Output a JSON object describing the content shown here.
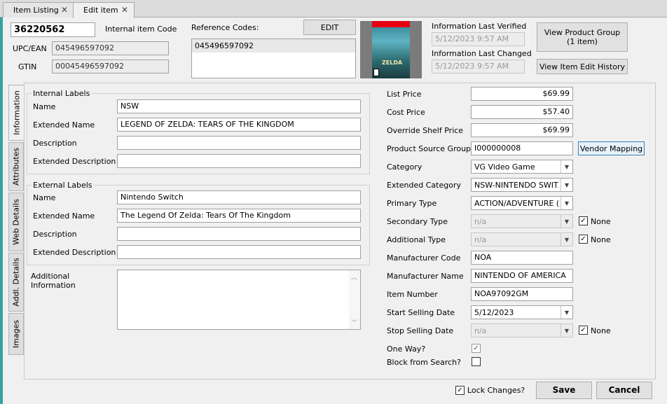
{
  "tabs": [
    {
      "label": "Item Listing"
    },
    {
      "label": "Edit item"
    }
  ],
  "header": {
    "item_code": "36220562",
    "internal_item_code_label": "Internal item Code",
    "upc_label": "UPC/EAN",
    "upc_value": "045496597092",
    "gtin_label": "GTIN",
    "gtin_value": "00045496597092",
    "ref_codes_label": "Reference Codes:",
    "edit_button": "EDIT",
    "ref_codes": [
      "045496597092"
    ],
    "info_verified_label": "Information Last Verified",
    "info_verified_value": "5/12/2023 9:57 AM",
    "info_changed_label": "Information Last Changed",
    "info_changed_value": "5/12/2023 9:57 AM",
    "view_product_group_line1": "View Product Group",
    "view_product_group_line2": "(1 item)",
    "view_edit_history": "View Item Edit History"
  },
  "side_tabs": [
    "Information",
    "Attributes",
    "Web Details",
    "Addl. Details",
    "Images"
  ],
  "internal_labels": {
    "legend": "Internal Labels",
    "name_label": "Name",
    "name": "NSW",
    "ext_name_label": "Extended Name",
    "ext_name": "LEGEND OF ZELDA: TEARS OF THE KINGDOM",
    "desc_label": "Description",
    "desc": "",
    "ext_desc_label": "Extended Description",
    "ext_desc": ""
  },
  "external_labels": {
    "legend": "External Labels",
    "name_label": "Name",
    "name": "Nintendo Switch",
    "ext_name_label": "Extended Name",
    "ext_name": "The Legend Of Zelda: Tears Of The Kingdom",
    "desc_label": "Description",
    "desc": "",
    "ext_desc_label": "Extended Description",
    "ext_desc": ""
  },
  "additional_info": {
    "label_line1": "Additional",
    "label_line2": "Information",
    "value": ""
  },
  "right": {
    "list_price_label": "List Price",
    "list_price": "$69.99",
    "cost_price_label": "Cost Price",
    "cost_price": "$57.40",
    "override_label": "Override Shelf Price",
    "override": "$69.99",
    "psg_label": "Product Source Group",
    "psg": "I000000008",
    "vendor_mapping": "Vendor Mapping",
    "category_label": "Category",
    "category": "VG Video Game",
    "ext_category_label": "Extended Category",
    "ext_category": "NSW-NINTENDO SWIT...",
    "primary_type_label": "Primary Type",
    "primary_type": "ACTION/ADVENTURE (...",
    "secondary_type_label": "Secondary Type",
    "secondary_type": "n/a",
    "additional_type_label": "Additional Type",
    "additional_type": "n/a",
    "none_label": "None",
    "mfr_code_label": "Manufacturer Code",
    "mfr_code": "NOA",
    "mfr_name_label": "Manufacturer Name",
    "mfr_name": "NINTENDO OF AMERICA",
    "item_number_label": "Item Number",
    "item_number": "NOA97092GM",
    "start_date_label": "Start Selling Date",
    "start_date": "5/12/2023",
    "stop_date_label": "Stop Selling Date",
    "stop_date": "n/a",
    "one_way_label": "One Way?",
    "block_label": "Block from Search?"
  },
  "footer": {
    "lock_label": "Lock Changes?",
    "save": "Save",
    "cancel": "Cancel"
  },
  "box_art": {
    "brand": "Nintendo Switch",
    "title": "ZELDA",
    "rating": "E"
  }
}
